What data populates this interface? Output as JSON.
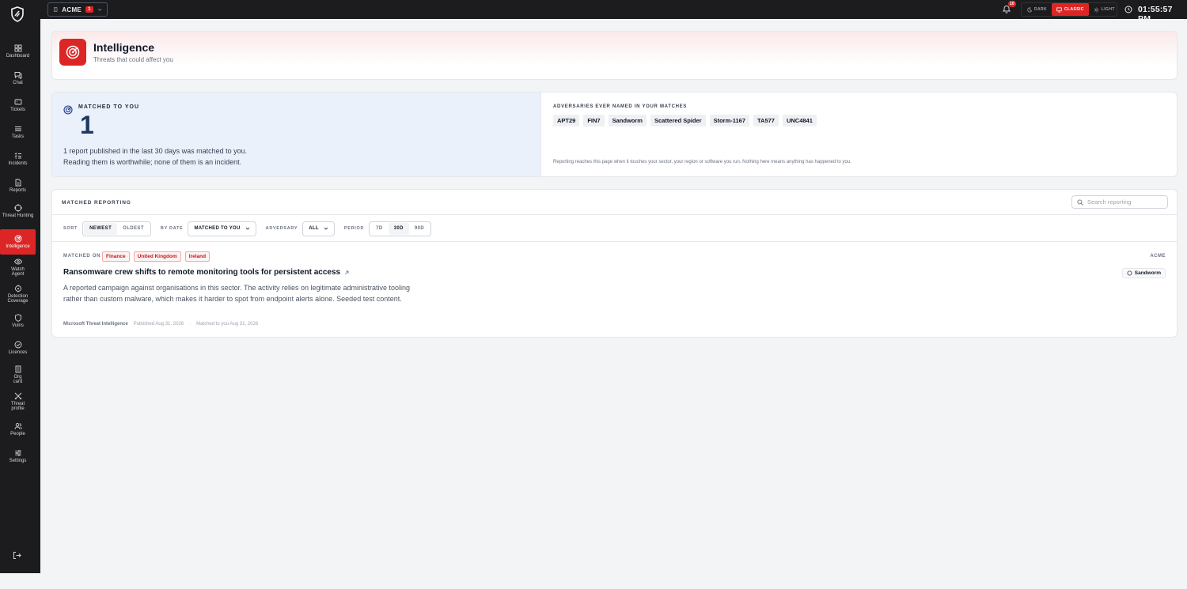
{
  "topbar": {
    "org_name": "ACME",
    "org_badge": "1",
    "notifications_count": "10",
    "themes": [
      {
        "label": "DARK",
        "active": false
      },
      {
        "label": "CLASSIC",
        "active": true
      },
      {
        "label": "LIGHT",
        "active": false
      }
    ],
    "time": "01:55:57 PM"
  },
  "sidebar": {
    "items": [
      {
        "label": "Dashboard",
        "icon": "dashboard-icon"
      },
      {
        "label": "Chat",
        "icon": "chat-icon"
      },
      {
        "label": "Tickets",
        "icon": "ticket-icon"
      },
      {
        "label": "Tasks",
        "icon": "tasks-icon"
      },
      {
        "label": "Incidents",
        "icon": "incidents-icon"
      },
      {
        "label": "Reports",
        "icon": "report-icon"
      },
      {
        "label": "Threat Hunting",
        "icon": "crosshair-icon"
      },
      {
        "label": "Intelligence",
        "icon": "radar-icon",
        "active": true
      },
      {
        "label": "Watch Agent",
        "icon": "eye-icon"
      },
      {
        "label": "Detection Coverage",
        "icon": "detection-icon"
      },
      {
        "label": "Vulns",
        "icon": "shield-icon"
      },
      {
        "label": "Licences",
        "icon": "check-circle-icon"
      },
      {
        "label": "Org card",
        "icon": "building-icon"
      },
      {
        "label": "Threat profile",
        "icon": "crossed-swords-icon"
      },
      {
        "label": "People",
        "icon": "people-icon"
      },
      {
        "label": "Settings",
        "icon": "sliders-icon"
      }
    ]
  },
  "header": {
    "title": "Intelligence",
    "subtitle": "Threats that could affect you"
  },
  "summary": {
    "matched_label": "MATCHED TO YOU",
    "matched_count": "1",
    "line1": "1 report published in the last 30 days was matched to you.",
    "line2": "Reading them is worthwhile; none of them is an incident.",
    "adversaries_label": "ADVERSARIES EVER NAMED IN YOUR MATCHES",
    "adversaries": [
      "APT29",
      "FIN7",
      "Sandworm",
      "Scattered Spider",
      "Storm-1167",
      "TA577",
      "UNC4841"
    ],
    "note": "Reporting reaches this page when it touches your sector, your region or software you run. Nothing here means anything has happened to you."
  },
  "reporting": {
    "title": "MATCHED REPORTING",
    "search_placeholder": "Search reporting",
    "filters": {
      "sort_label": "SORT",
      "sort_options": [
        "NEWEST",
        "OLDEST"
      ],
      "by_date_label": "BY DATE",
      "by_date_value": "MATCHED TO YOU",
      "adversary_label": "ADVERSARY",
      "adversary_value": "ALL",
      "period_label": "PERIOD",
      "period_options": [
        "7D",
        "30D",
        "90D"
      ]
    },
    "items": [
      {
        "matched_on_label": "MATCHED ON",
        "tags": [
          "Finance",
          "United Kingdom",
          "Ireland"
        ],
        "org": "ACME",
        "title": "Ransomware crew shifts to remote monitoring tools for persistent access",
        "actor": "Sandworm",
        "body": "A reported campaign against organisations in this sector. The activity relies on legitimate administrative tooling rather than custom malware, which makes it harder to spot from endpoint alerts alone. Seeded test content.",
        "source": "Microsoft Threat Intelligence",
        "published": "Published Aug 31, 2026",
        "matched": "Matched to you Aug 31, 2026"
      }
    ]
  },
  "colors": {
    "accent": "#dc2626",
    "chrome": "#1c1c1e",
    "summary_bg": "#eaf1fb"
  }
}
